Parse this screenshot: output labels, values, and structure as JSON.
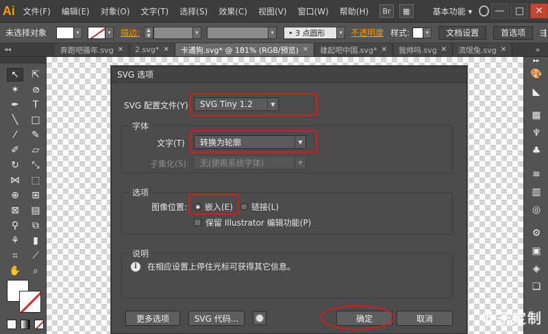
{
  "app": {
    "logo": "Ai"
  },
  "menu": [
    "文件(F)",
    "编辑(E)",
    "对象(O)",
    "文字(T)",
    "选择(S)",
    "效果(C)",
    "视图(V)",
    "窗口(W)",
    "帮助(H)"
  ],
  "menubar": {
    "br_icon": "Br",
    "workspace": "基本功能 ▾",
    "win_minimize": "—",
    "win_restore": "□",
    "win_close": "✕"
  },
  "control": {
    "selection": "未选择对象",
    "stroke_label": "描边:",
    "brush_value": "• 3 点圆形",
    "opacity_label": "不透明度",
    "style_label": "样式:",
    "doc_setup": "文档设置",
    "preferences": "首选项"
  },
  "tabs": [
    {
      "label": "奔跑吧骚年.svg",
      "active": false
    },
    {
      "label": "2.svg*",
      "active": false
    },
    {
      "label": "卡通狗.svg* @ 181% (RGB/预览)",
      "active": true
    },
    {
      "label": "雄起吧中国.svg*",
      "active": false
    },
    {
      "label": "我帅吗.svg",
      "active": false
    },
    {
      "label": "流氓兔.svg",
      "active": false
    }
  ],
  "dialog": {
    "title": "SVG 选项",
    "profile_label": "SVG 配置文件(Y)",
    "profile_value": "SVG Tiny 1.2",
    "font_group": "字体",
    "type_label": "文字(T)",
    "type_value": "转换为轮廓",
    "subset_label": "子集化(S):",
    "subset_value": "无(使用系统字体)",
    "options_group": "选项",
    "image_loc_label": "图像位置:",
    "embed_label": "嵌入(E)",
    "link_label": "链接(L)",
    "preserve_label": "保留 Illustrator 编辑功能(P)",
    "desc_group": "说明",
    "desc_text": "在相应设置上停住光标可获得其它信息。",
    "more_options": "更多选项",
    "svg_code": "SVG 代码...",
    "ok": "确定",
    "cancel": "取消"
  },
  "watermark": "叶子定制",
  "colors": {
    "accent_orange": "#ff9a00",
    "highlight_red": "#e01818"
  }
}
